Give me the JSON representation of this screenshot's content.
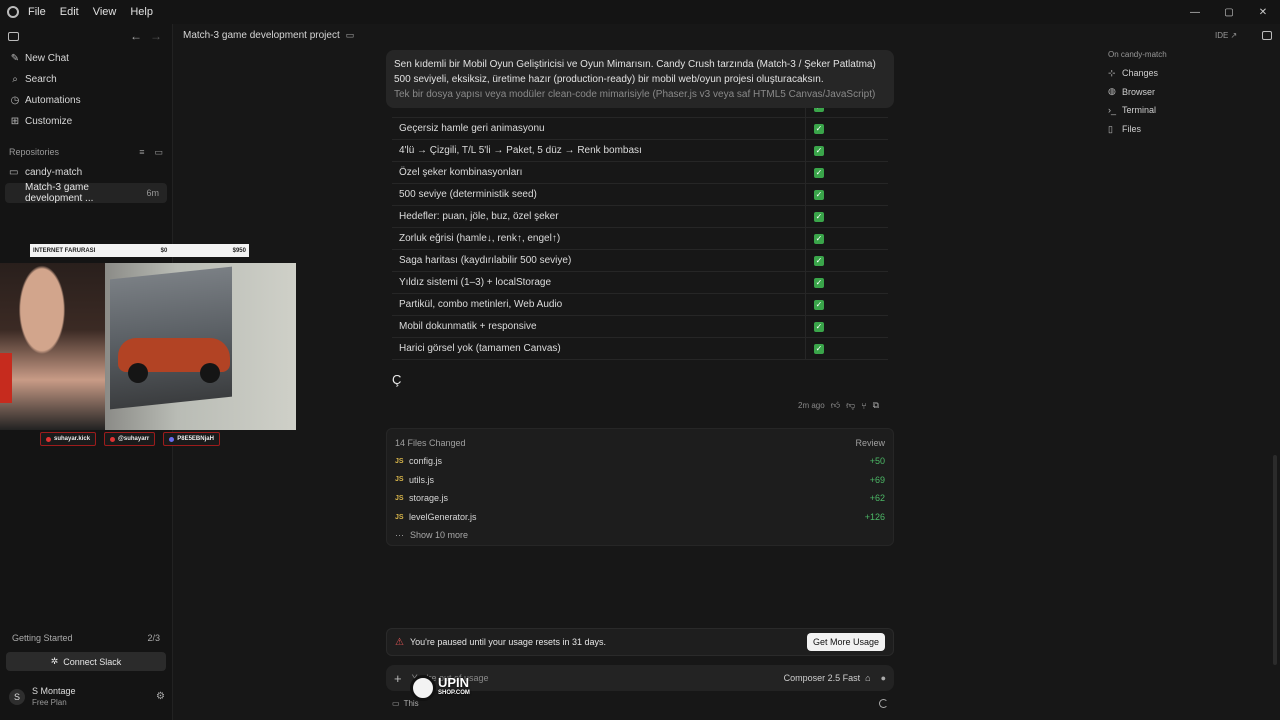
{
  "menubar": {
    "items": [
      "File",
      "Edit",
      "View",
      "Help"
    ]
  },
  "window_controls": {
    "minimize": "—",
    "maximize": "▢",
    "close": "✕"
  },
  "sidebar": {
    "nav": [
      {
        "label": "New Chat",
        "icon": "new-chat-icon"
      },
      {
        "label": "Search",
        "icon": "search-icon"
      },
      {
        "label": "Automations",
        "icon": "automations-icon"
      },
      {
        "label": "Customize",
        "icon": "customize-icon"
      }
    ],
    "repositories_label": "Repositories",
    "repo": "candy-match",
    "chat": {
      "title": "Match-3 game development ...",
      "time": "6m"
    },
    "getting_started": {
      "label": "Getting Started",
      "progress": "2/3",
      "button": "Connect Slack"
    },
    "user": {
      "initial": "S",
      "name": "S Montage",
      "plan": "Free Plan"
    }
  },
  "overlay": {
    "stream_bar": {
      "label": "INTERNET FARURASI",
      "start": "$0",
      "end": "$950"
    },
    "socials": [
      "suhayar.kick",
      "@suhayarr",
      "P8E5EBNjaH"
    ]
  },
  "header": {
    "title": "Match-3 game development project"
  },
  "right_panel": {
    "ide": "IDE ↗",
    "header": "On candy-match",
    "items": [
      {
        "label": "Changes",
        "icon": "changes-icon"
      },
      {
        "label": "Browser",
        "icon": "globe-icon"
      },
      {
        "label": "Terminal",
        "icon": "terminal-icon"
      },
      {
        "label": "Files",
        "icon": "files-icon"
      }
    ]
  },
  "prompt": {
    "line1": "Sen kıdemli bir Mobil Oyun Geliştiricisi ve Oyun Mimarısın. Candy Crush tarzında (Match-3 / Şeker Patlatma)",
    "line2": "500 seviyeli, eksiksiz, üretime hazır (production-ready) bir mobil web/oyun projesi oluşturacaksın.",
    "line3": "Tek bir dosya yapısı veya modüler clean-code mimarisiyle (Phaser.js v3 veya saf HTML5 Canvas/JavaScript)"
  },
  "features": [
    "Geçersiz hamle geri animasyonu",
    "4'lü → Çizgili, T/L 5'li → Paket, 5 düz → Renk bombası",
    "Özel şeker kombinasyonları",
    "500 seviye (deterministik seed)",
    "Hedefler: puan, jöle, buz, özel şeker",
    "Zorluk eğrisi (hamle↓, renk↑, engel↑)",
    "Saga haritası (kaydırılabilir 500 seviye)",
    "Yıldız sistemi (1–3) + localStorage",
    "Partikül, combo metinleri, Web Audio",
    "Mobil dokunmatik + responsive",
    "Harici görsel yok (tamamen Canvas)"
  ],
  "partial_text": "Ç",
  "message_meta": {
    "time": "2m ago"
  },
  "files_changed": {
    "title": "14 Files Changed",
    "review": "Review",
    "files": [
      {
        "name": "config.js",
        "added": "+50"
      },
      {
        "name": "utils.js",
        "added": "+69"
      },
      {
        "name": "storage.js",
        "added": "+62"
      },
      {
        "name": "levelGenerator.js",
        "added": "+126"
      }
    ],
    "show_more": "Show 10 more"
  },
  "paused": {
    "text": "You're paused until your usage resets in 31 days.",
    "button": "Get More Usage"
  },
  "composer": {
    "placeholder": "You're out of usage",
    "model": "Composer 2.5 Fast"
  },
  "watermark": {
    "text": "UPIN",
    "sub": "SHOP.COM"
  },
  "bottom": {
    "label": "This"
  }
}
